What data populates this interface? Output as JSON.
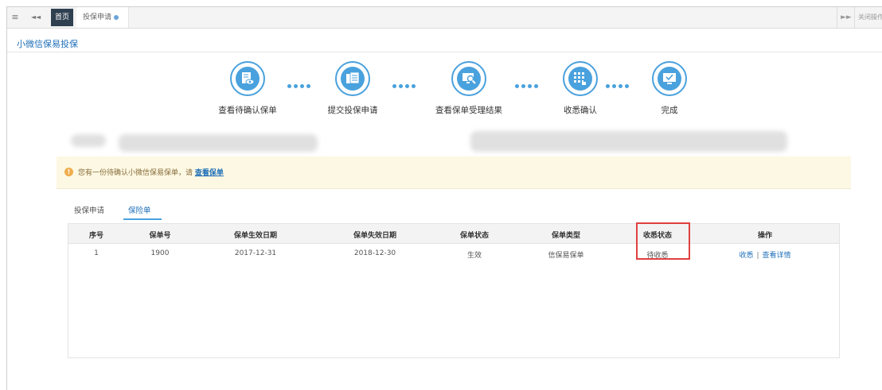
{
  "tabbar": {
    "menu_icon": "≡",
    "back_icon": "◄◄",
    "tabs": [
      {
        "label": "首页",
        "active": true
      },
      {
        "label": "投保申请",
        "active": false
      }
    ],
    "forward_icon": "►►",
    "close_ops_label": "关闭操作"
  },
  "page_title": "小微信保易投保",
  "steps": [
    {
      "label": "查看待确认保单",
      "icon": "document-eye-icon"
    },
    {
      "label": "提交投保申请",
      "icon": "document-form-icon"
    },
    {
      "label": "查看保单受理结果",
      "icon": "monitor-search-icon"
    },
    {
      "label": "收悉确认",
      "icon": "keypad-touch-icon"
    },
    {
      "label": "完成",
      "icon": "monitor-check-icon"
    }
  ],
  "alert": {
    "text": "您有一份待确认小微信保易保单，请",
    "link": "查看保单"
  },
  "subtabs": [
    {
      "label": "投保申请",
      "active": false
    },
    {
      "label": "保险单",
      "active": true
    }
  ],
  "table": {
    "headers": [
      "序号",
      "保单号",
      "保单生效日期",
      "保单失效日期",
      "保单状态",
      "保单类型",
      "收悉状态",
      "操作"
    ],
    "rows": [
      {
        "index": "1",
        "policy_no": "1900",
        "start_date": "2017-12-31",
        "end_date": "2018-12-30",
        "status": "生效",
        "type": "信保易保单",
        "receipt_status": "待收悉",
        "ops": [
          "收悉",
          "查看详情"
        ]
      }
    ]
  },
  "colors": {
    "accent": "#49a1dd",
    "link": "#1f6fb8",
    "alert_bg": "#fcf8e3",
    "highlight": "#e04040"
  }
}
